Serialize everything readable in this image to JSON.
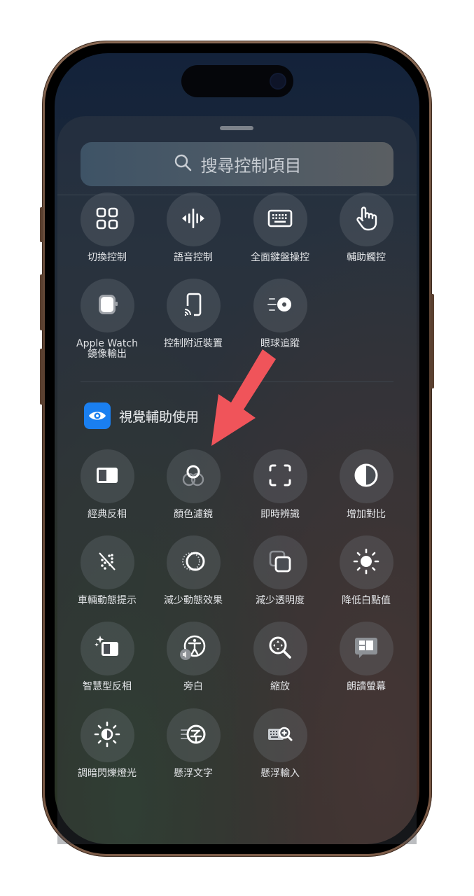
{
  "search": {
    "placeholder": "搜尋控制項目",
    "icon": "magnifying-glass-icon"
  },
  "accent_colors": {
    "section_icon": "#1a7ff0",
    "annotation_arrow": "#f0545a"
  },
  "motor_controls": [
    {
      "label": "切換控制",
      "icon": "switch-control-grid-icon"
    },
    {
      "label": "語音控制",
      "icon": "voice-control-waveform-icon"
    },
    {
      "label": "全面鍵盤操控",
      "icon": "keyboard-icon"
    },
    {
      "label": "輔助觸控",
      "icon": "assistive-touch-hand-icon"
    },
    {
      "label": "Apple Watch\n鏡像輸出",
      "icon": "apple-watch-icon"
    },
    {
      "label": "控制附近裝置",
      "icon": "nearby-device-icon"
    },
    {
      "label": "眼球追蹤",
      "icon": "eye-tracking-icon"
    }
  ],
  "vision_section": {
    "title": "視覺輔助使用",
    "icon": "eye-icon",
    "items": [
      {
        "label": "經典反相",
        "icon": "classic-invert-icon"
      },
      {
        "label": "顏色濾鏡",
        "icon": "color-filters-icon"
      },
      {
        "label": "即時辨識",
        "icon": "live-recognition-icon"
      },
      {
        "label": "增加對比",
        "icon": "increase-contrast-icon"
      },
      {
        "label": "車輛動態提示",
        "icon": "vehicle-motion-cues-icon"
      },
      {
        "label": "減少動態效果",
        "icon": "reduce-motion-icon"
      },
      {
        "label": "減少透明度",
        "icon": "reduce-transparency-icon"
      },
      {
        "label": "降低白點值",
        "icon": "reduce-white-point-icon"
      },
      {
        "label": "智慧型反相",
        "icon": "smart-invert-icon"
      },
      {
        "label": "旁白",
        "icon": "voiceover-icon"
      },
      {
        "label": "縮放",
        "icon": "zoom-icon"
      },
      {
        "label": "朗讀螢幕",
        "icon": "speak-screen-icon"
      },
      {
        "label": "調暗閃爍燈光",
        "icon": "dim-flashing-lights-icon"
      },
      {
        "label": "懸浮文字",
        "icon": "hover-text-icon"
      },
      {
        "label": "懸浮輸入",
        "icon": "hover-typing-icon"
      }
    ]
  }
}
